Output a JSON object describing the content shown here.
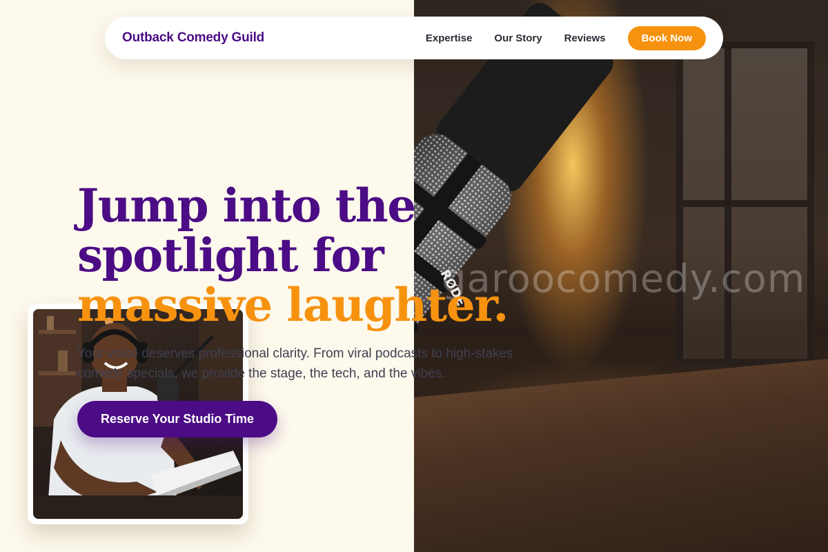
{
  "header": {
    "brand": "Outback Comedy Guild",
    "nav": [
      {
        "label": "Expertise"
      },
      {
        "label": "Our Story"
      },
      {
        "label": "Reviews"
      }
    ],
    "cta_label": "Book Now"
  },
  "hero": {
    "title_line1": "Jump into the",
    "title_line2": "spotlight for",
    "title_accent": "massive laughter.",
    "description": "Your voice deserves professional clarity. From viral podcasts to high-stakes comedy specials, we provide the stage, the tech, and the vibes.",
    "cta_label": "Reserve Your Studio Time"
  },
  "media": {
    "watermark": "garoocomedy.com",
    "mic_brand": "RØDE"
  },
  "colors": {
    "brand_purple": "#4b0c85",
    "accent_orange": "#f7920f",
    "page_background": "#fdf9ec"
  }
}
